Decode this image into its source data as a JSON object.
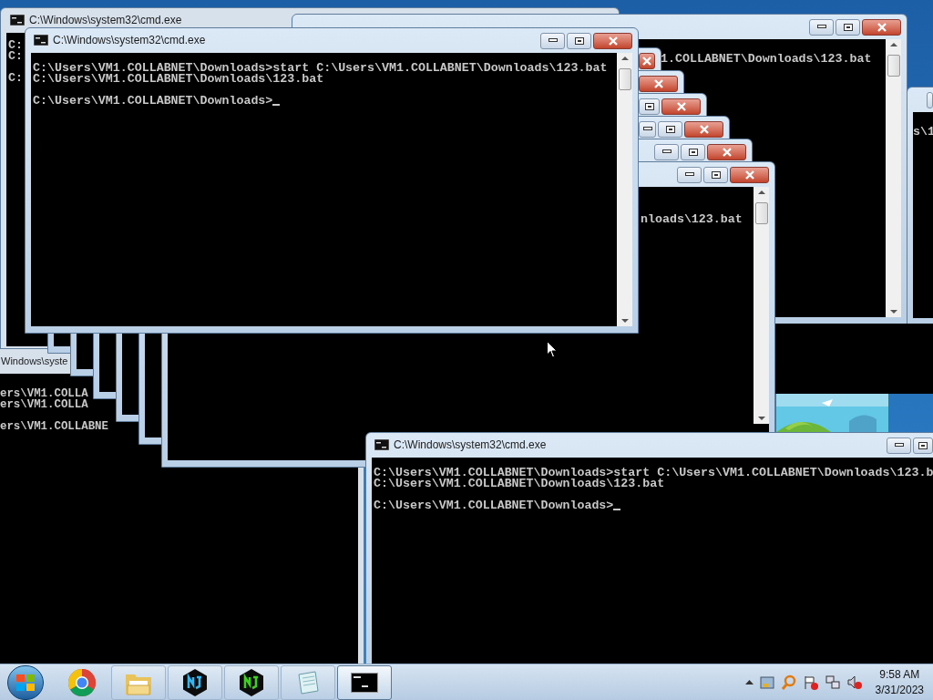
{
  "windows": [
    {
      "title": "C:\\Windows\\system32\\cmd.exe",
      "output": [
        [
          "C:",
          "C:"
        ],
        [
          "C:"
        ]
      ]
    },
    {
      "output": [
        [
          "1.COLLABNET\\Downloads\\123.bat"
        ]
      ]
    },
    {
      "output": [
        [
          "s\\1"
        ]
      ]
    },
    {
      "output": [
        [
          "nloads\\123.bat"
        ]
      ]
    },
    {
      "title": "Windows\\syste",
      "output": [
        [
          "ers\\VM1.COLLA",
          "ers\\VM1.COLLA"
        ],
        [
          "ers\\VM1.COLLABNE"
        ]
      ]
    },
    {
      "title": "C:\\Windows\\system32\\cmd.exe",
      "output": [
        [
          "C:\\Users\\VM1.COLLABNET\\Downloads>start C:\\Users\\VM1.COLLABNET\\Downloads\\123.bat",
          "C:\\Users\\VM1.COLLABNET\\Downloads\\123.bat"
        ],
        [
          "C:\\Users\\VM1.COLLABNET\\Downloads>"
        ]
      ],
      "cursor": true
    },
    {
      "title": "C:\\Windows\\system32\\cmd.exe",
      "output": [
        [
          "C:\\Users\\VM1.COLLABNET\\Downloads>start C:\\Users\\VM1.COLLABNET\\Downloads\\123.b",
          "C:\\Users\\VM1.COLLABNET\\Downloads\\123.bat"
        ],
        [
          "C:\\Users\\VM1.COLLABNET\\Downloads>"
        ]
      ],
      "cursor": true
    }
  ],
  "taskbar": {
    "apps": [
      {
        "kind": "chrome",
        "selected": false
      },
      {
        "kind": "explorer",
        "selected": false
      },
      {
        "kind": "nj",
        "color": "#35b6ee",
        "selected": false
      },
      {
        "kind": "nj",
        "color": "#3fcf1f",
        "selected": false
      },
      {
        "kind": "notepad",
        "selected": false
      },
      {
        "kind": "console",
        "selected": true
      }
    ],
    "time": "9:58 AM",
    "date": "3/31/2023"
  }
}
